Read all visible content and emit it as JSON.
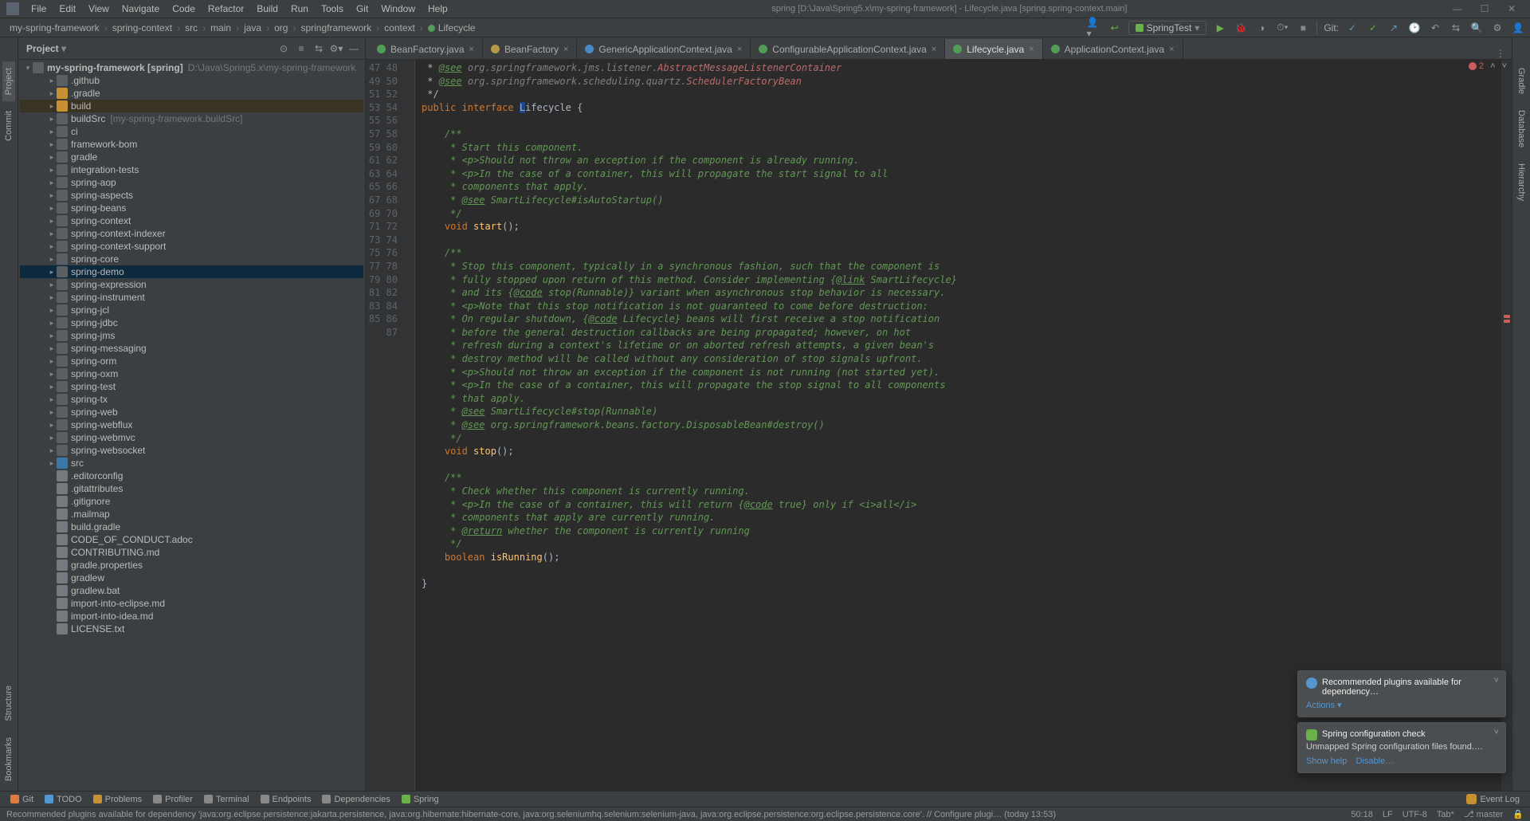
{
  "window_title": "spring [D:\\Java\\Spring5.x\\my-spring-framework] - Lifecycle.java [spring.spring-context.main]",
  "menu": [
    "File",
    "Edit",
    "View",
    "Navigate",
    "Code",
    "Refactor",
    "Build",
    "Run",
    "Tools",
    "Git",
    "Window",
    "Help"
  ],
  "breadcrumbs": [
    "my-spring-framework",
    "spring-context",
    "src",
    "main",
    "java",
    "org",
    "springframework",
    "context",
    "Lifecycle"
  ],
  "run_config": "SpringTest",
  "git_label": "Git:",
  "project": {
    "panel_title": "Project",
    "root": {
      "label": "my-spring-framework [spring]",
      "path": "D:\\Java\\Spring5.x\\my-spring-framework"
    },
    "items": [
      {
        "d": 1,
        "e": false,
        "ico": "folder",
        "label": ".github"
      },
      {
        "d": 1,
        "e": false,
        "ico": "folder-orange",
        "label": ".gradle"
      },
      {
        "d": 1,
        "e": false,
        "ico": "folder-orange",
        "label": "build",
        "sel": false,
        "hl": true
      },
      {
        "d": 1,
        "e": false,
        "ico": "folder",
        "label": "buildSrc",
        "path": "[my-spring-framework.buildSrc]"
      },
      {
        "d": 1,
        "e": false,
        "ico": "folder",
        "label": "ci"
      },
      {
        "d": 1,
        "e": false,
        "ico": "folder",
        "label": "framework-bom"
      },
      {
        "d": 1,
        "e": false,
        "ico": "folder",
        "label": "gradle"
      },
      {
        "d": 1,
        "e": false,
        "ico": "folder",
        "label": "integration-tests"
      },
      {
        "d": 1,
        "e": false,
        "ico": "folder",
        "label": "spring-aop"
      },
      {
        "d": 1,
        "e": false,
        "ico": "folder",
        "label": "spring-aspects"
      },
      {
        "d": 1,
        "e": false,
        "ico": "folder",
        "label": "spring-beans"
      },
      {
        "d": 1,
        "e": false,
        "ico": "folder",
        "label": "spring-context"
      },
      {
        "d": 1,
        "e": false,
        "ico": "folder",
        "label": "spring-context-indexer"
      },
      {
        "d": 1,
        "e": false,
        "ico": "folder",
        "label": "spring-context-support"
      },
      {
        "d": 1,
        "e": false,
        "ico": "folder",
        "label": "spring-core"
      },
      {
        "d": 1,
        "e": false,
        "ico": "folder",
        "label": "spring-demo",
        "sel": true
      },
      {
        "d": 1,
        "e": false,
        "ico": "folder",
        "label": "spring-expression"
      },
      {
        "d": 1,
        "e": false,
        "ico": "folder",
        "label": "spring-instrument"
      },
      {
        "d": 1,
        "e": false,
        "ico": "folder",
        "label": "spring-jcl"
      },
      {
        "d": 1,
        "e": false,
        "ico": "folder",
        "label": "spring-jdbc"
      },
      {
        "d": 1,
        "e": false,
        "ico": "folder",
        "label": "spring-jms"
      },
      {
        "d": 1,
        "e": false,
        "ico": "folder",
        "label": "spring-messaging"
      },
      {
        "d": 1,
        "e": false,
        "ico": "folder",
        "label": "spring-orm"
      },
      {
        "d": 1,
        "e": false,
        "ico": "folder",
        "label": "spring-oxm"
      },
      {
        "d": 1,
        "e": false,
        "ico": "folder",
        "label": "spring-test"
      },
      {
        "d": 1,
        "e": false,
        "ico": "folder",
        "label": "spring-tx"
      },
      {
        "d": 1,
        "e": false,
        "ico": "folder",
        "label": "spring-web"
      },
      {
        "d": 1,
        "e": false,
        "ico": "folder",
        "label": "spring-webflux"
      },
      {
        "d": 1,
        "e": false,
        "ico": "folder",
        "label": "spring-webmvc"
      },
      {
        "d": 1,
        "e": false,
        "ico": "folder",
        "label": "spring-websocket"
      },
      {
        "d": 1,
        "e": false,
        "ico": "folder-blue",
        "label": "src"
      },
      {
        "d": 1,
        "e": null,
        "ico": "file",
        "label": ".editorconfig"
      },
      {
        "d": 1,
        "e": null,
        "ico": "file",
        "label": ".gitattributes"
      },
      {
        "d": 1,
        "e": null,
        "ico": "file",
        "label": ".gitignore"
      },
      {
        "d": 1,
        "e": null,
        "ico": "file",
        "label": ".mailmap"
      },
      {
        "d": 1,
        "e": null,
        "ico": "file",
        "label": "build.gradle"
      },
      {
        "d": 1,
        "e": null,
        "ico": "file",
        "label": "CODE_OF_CONDUCT.adoc"
      },
      {
        "d": 1,
        "e": null,
        "ico": "file",
        "label": "CONTRIBUTING.md"
      },
      {
        "d": 1,
        "e": null,
        "ico": "file",
        "label": "gradle.properties"
      },
      {
        "d": 1,
        "e": null,
        "ico": "file",
        "label": "gradlew"
      },
      {
        "d": 1,
        "e": null,
        "ico": "file",
        "label": "gradlew.bat"
      },
      {
        "d": 1,
        "e": null,
        "ico": "file",
        "label": "import-into-eclipse.md"
      },
      {
        "d": 1,
        "e": null,
        "ico": "file",
        "label": "import-into-idea.md"
      },
      {
        "d": 1,
        "e": null,
        "ico": "file",
        "label": "LICENSE.txt"
      }
    ]
  },
  "left_tabs": [
    "Project",
    "Commit"
  ],
  "left_tabs_bottom": [
    "Structure",
    "Bookmarks"
  ],
  "right_tabs": [
    "Gradle",
    "Database",
    "Hierarchy"
  ],
  "editor_tabs": [
    {
      "ico": "i-if",
      "label": "BeanFactory.java",
      "close": true
    },
    {
      "ico": "i-abs",
      "label": "BeanFactory",
      "close": true
    },
    {
      "ico": "i-cl",
      "label": "GenericApplicationContext.java",
      "close": true
    },
    {
      "ico": "i-if",
      "label": "ConfigurableApplicationContext.java",
      "close": true
    },
    {
      "ico": "i-if",
      "label": "Lifecycle.java",
      "close": true,
      "active": true
    },
    {
      "ico": "i-if",
      "label": "ApplicationContext.java",
      "close": true
    }
  ],
  "error_count": "2",
  "code_start": 47,
  "code_lines": [
    " * <span class='doc-tag'>@see</span> <span class='pkg-dim'>org.springframework.jms.listener.</span><span class='err'>AbstractMessageListenerContainer</span>",
    " * <span class='doc-tag'>@see</span> <span class='pkg-dim'>org.springframework.scheduling.quartz.</span><span class='err'>SchedulerFactoryBean</span>",
    " */",
    "<span class='kw'>public interface </span><span style='background:#214283'>L</span>ifecycle {",
    "",
    "    <span class='doc'>/**</span>",
    "    <span class='doc'> * Start this component.</span>",
    "    <span class='doc'> * &lt;p&gt;Should not throw an exception if the component is already running.</span>",
    "    <span class='doc'> * &lt;p&gt;In the case of a container, this will propagate the start signal to all</span>",
    "    <span class='doc'> * components that apply.</span>",
    "    <span class='doc'> * <span class='doc-tag'>@see</span> SmartLifecycle#isAutoStartup()</span>",
    "    <span class='doc'> */</span>",
    "    <span class='kw'>void</span> <span class='fn'>start</span>();",
    "",
    "    <span class='doc'>/**</span>",
    "    <span class='doc'> * Stop this component, typically in a synchronous fashion, such that the component is</span>",
    "    <span class='doc'> * fully stopped upon return of this method. Consider implementing {<span class='doc-tag'>@link</span> SmartLifecycle}</span>",
    "    <span class='doc'> * and its {<span class='doc-tag'>@code</span> stop(Runnable)} variant when asynchronous stop behavior is necessary.</span>",
    "    <span class='doc'> * &lt;p&gt;Note that this stop notification is not guaranteed to come before destruction:</span>",
    "    <span class='doc'> * On regular shutdown, {<span class='doc-tag'>@code</span> Lifecycle} beans will first receive a stop notification</span>",
    "    <span class='doc'> * before the general destruction callbacks are being propagated; however, on hot</span>",
    "    <span class='doc'> * refresh during a context's lifetime or on aborted refresh attempts, a given bean's</span>",
    "    <span class='doc'> * destroy method will be called without any consideration of stop signals upfront.</span>",
    "    <span class='doc'> * &lt;p&gt;Should not throw an exception if the component is not running (not started yet).</span>",
    "    <span class='doc'> * &lt;p&gt;In the case of a container, this will propagate the stop signal to all components</span>",
    "    <span class='doc'> * that apply.</span>",
    "    <span class='doc'> * <span class='doc-tag'>@see</span> SmartLifecycle#stop(Runnable)</span>",
    "    <span class='doc'> * <span class='doc-tag'>@see</span> org.springframework.beans.factory.DisposableBean#destroy()</span>",
    "    <span class='doc'> */</span>",
    "    <span class='kw'>void</span> <span class='fn'>stop</span>();",
    "",
    "    <span class='doc'>/**</span>",
    "    <span class='doc'> * Check whether this component is currently running.</span>",
    "    <span class='doc'> * &lt;p&gt;In the case of a container, this will return {<span class='doc-tag'>@code</span> true} only if &lt;i&gt;all&lt;/i&gt;</span>",
    "    <span class='doc'> * components that apply are currently running.</span>",
    "    <span class='doc'> * <span class='doc-tag'>@return</span> whether the component is currently running</span>",
    "    <span class='doc'> */</span>",
    "    <span class='kw'>boolean</span> <span class='fn'>isRunning</span>();",
    "",
    "}",
    ""
  ],
  "bottom_tabs": [
    "Git",
    "TODO",
    "Problems",
    "Profiler",
    "Terminal",
    "Endpoints",
    "Dependencies",
    "Spring"
  ],
  "event_log": "Event Log",
  "status_msg": "Recommended plugins available for dependency 'java:org.eclipse.persistence:jakarta.persistence, java:org.hibernate:hibernate-core, java:org.seleniumhq.selenium:selenium-java, java:org.eclipse.persistence:org.eclipse.persistence.core'. // Configure plugi… (today 13:53)",
  "status_pos": "50:18",
  "status_lf": "LF",
  "status_enc": "UTF-8",
  "status_tab": "Tab*",
  "status_branch": "master",
  "popup1": {
    "title": "Recommended plugins available for dependency…",
    "actions": "Actions"
  },
  "popup2": {
    "title": "Spring configuration check",
    "body": "Unmapped Spring configuration files found.…",
    "show": "Show help",
    "disable": "Disable…"
  }
}
